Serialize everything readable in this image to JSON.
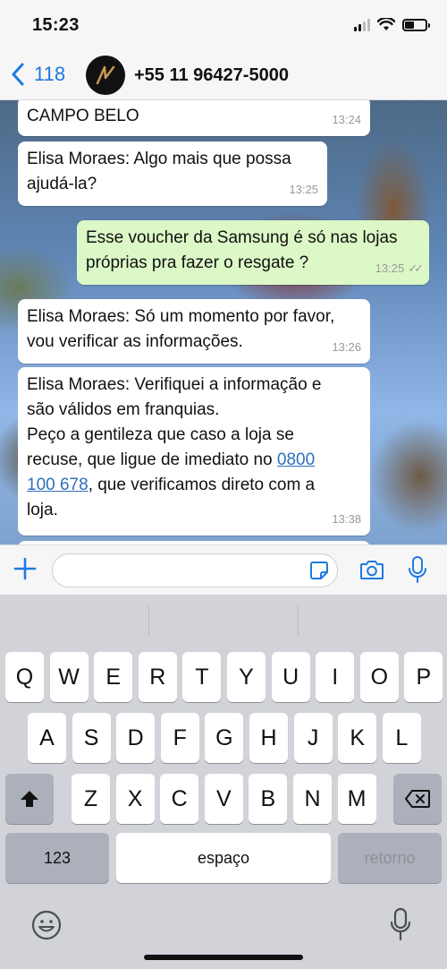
{
  "status_bar": {
    "time": "15:23"
  },
  "header": {
    "back_count": "118",
    "contact": "+55 11 96427-5000"
  },
  "messages": [
    {
      "direction": "in",
      "text": "CAMPO BELO",
      "time": "13:24"
    },
    {
      "direction": "in",
      "text": "Elisa Moraes: Algo mais que possa\najudá-la?",
      "time": "13:25"
    },
    {
      "direction": "out",
      "text": "Esse voucher da Samsung é só nas lojas\npróprias pra fazer o resgate ?",
      "time": "13:25",
      "status": "read"
    },
    {
      "direction": "in",
      "text": "Elisa Moraes: Só um momento por favor,\nvou verificar as informações.",
      "time": "13:26"
    },
    {
      "direction": "in",
      "text_before": "Elisa Moraes: Verifiquei a informação e\nsão válidos em franquias.\nPeço a gentileza que caso a loja se\nrecuse, que ligue de imediato no ",
      "link_text": "0800\n100 678",
      "text_after": ", que verificamos direto com a\nloja.",
      "time": "13:38"
    }
  ],
  "input": {
    "placeholder": "",
    "value": ""
  },
  "keyboard": {
    "row1": [
      "Q",
      "W",
      "E",
      "R",
      "T",
      "Y",
      "U",
      "I",
      "O",
      "P"
    ],
    "row2": [
      "A",
      "S",
      "D",
      "F",
      "G",
      "H",
      "J",
      "K",
      "L"
    ],
    "row3": [
      "Z",
      "X",
      "C",
      "V",
      "B",
      "N",
      "M"
    ],
    "numbers_label": "123",
    "space_label": "espaço",
    "return_label": "retorno"
  },
  "icons": {
    "back": "chevron-left-icon",
    "plus": "plus-icon",
    "sticker": "sticker-icon",
    "camera": "camera-icon",
    "mic": "microphone-icon",
    "shift": "shift-icon",
    "backspace": "backspace-icon",
    "emoji": "emoji-icon",
    "dictation": "microphone-icon"
  },
  "colors": {
    "accent": "#1f7ae0",
    "outgoing_bubble": "#dcf8c6",
    "incoming_bubble": "#ffffff",
    "link": "#2f6fbd"
  }
}
